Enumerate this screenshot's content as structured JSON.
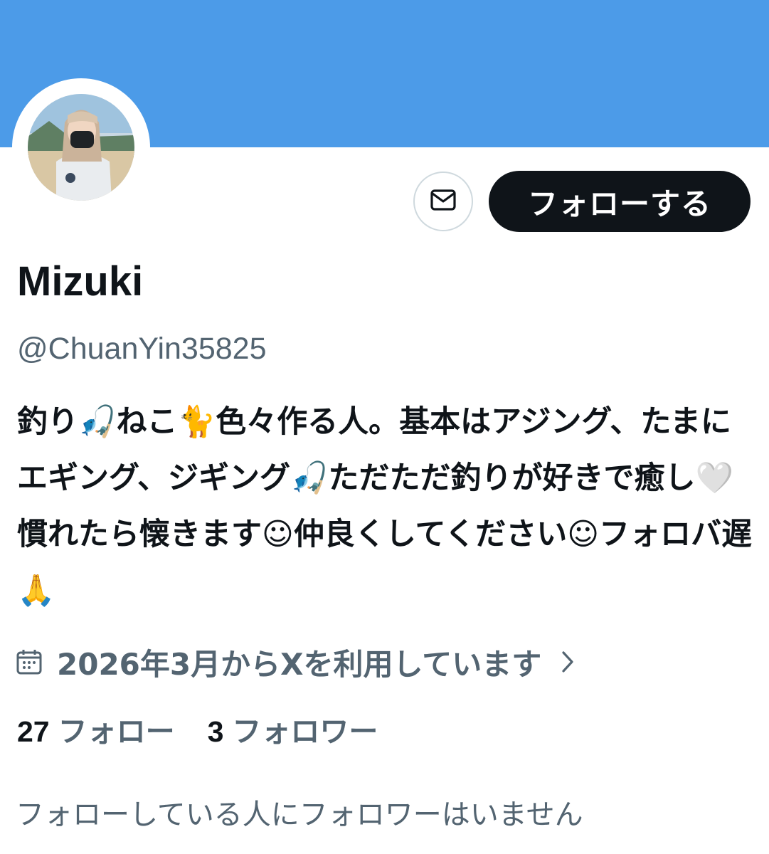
{
  "profile": {
    "display_name": "Mizuki",
    "handle": "@ChuanYin35825",
    "bio": "釣り🎣ねこ🐈色々作る人。基本はアジング、たまにエギング、ジギング🎣ただただ釣りが好きで癒し🤍慣れたら懐きます☺仲良くしてください☺フォロバ遅🙏",
    "joined": "2026年3月からXを利用しています"
  },
  "actions": {
    "follow_label": "フォローする",
    "message_icon": "mail-icon"
  },
  "stats": {
    "following_count": "27",
    "following_label": "フォロー",
    "followers_count": "3",
    "followers_label": "フォロワー"
  },
  "followers_you_know": "フォローしている人にフォロワーはいません",
  "colors": {
    "banner": "#4c9be8",
    "text_primary": "#0f1419",
    "text_secondary": "#536471",
    "button_dark": "#0f1419"
  }
}
